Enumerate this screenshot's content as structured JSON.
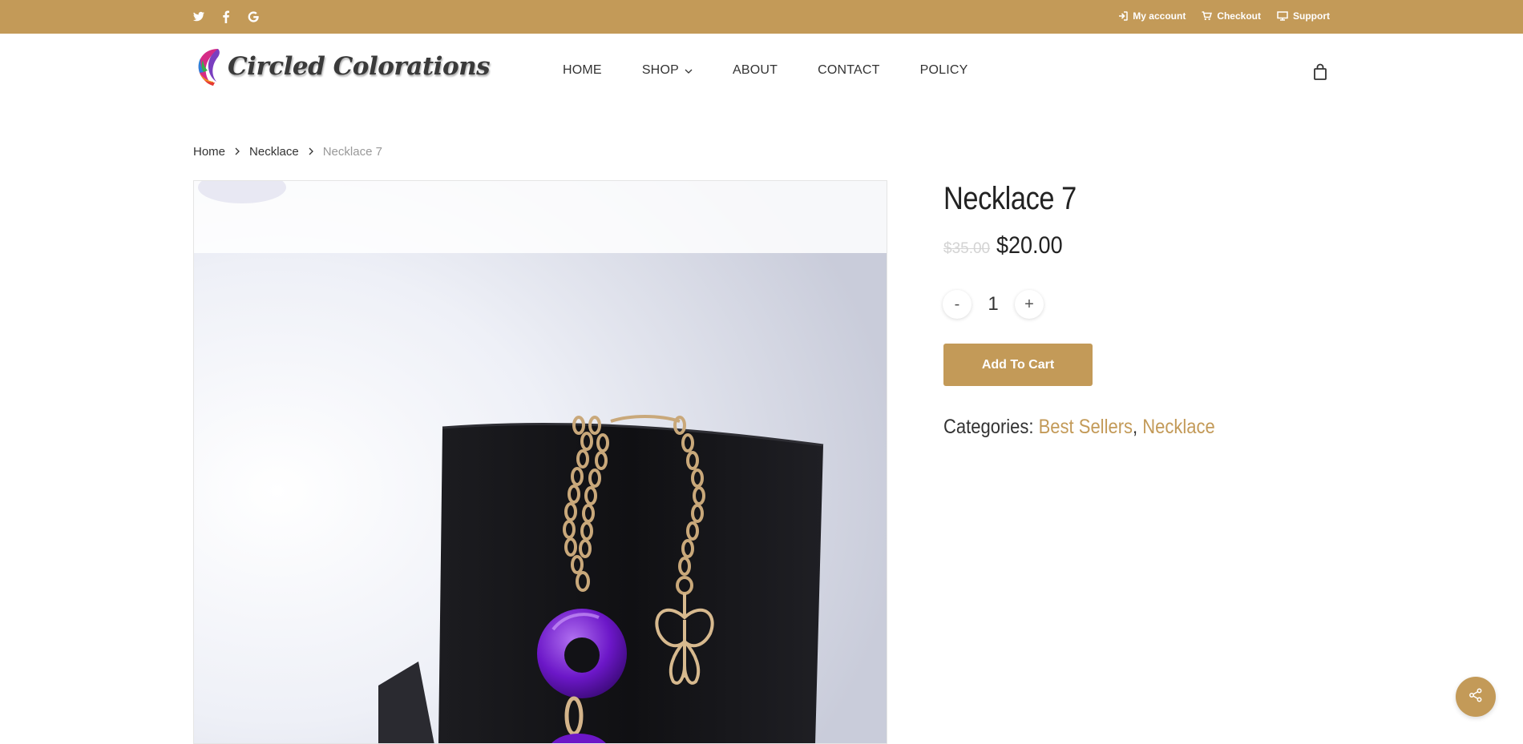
{
  "topbar": {
    "social": [
      "twitter-icon",
      "facebook-icon",
      "google-icon"
    ],
    "links": [
      {
        "label": "My account",
        "icon": "sign-in-icon"
      },
      {
        "label": "Checkout",
        "icon": "cart-icon"
      },
      {
        "label": "Support",
        "icon": "monitor-icon"
      }
    ]
  },
  "header": {
    "logo_text": "Circled Colorations",
    "nav": [
      "HOME",
      "SHOP",
      "ABOUT",
      "CONTACT",
      "POLICY"
    ]
  },
  "breadcrumb": {
    "items": [
      "Home",
      "Necklace"
    ],
    "current": "Necklace 7"
  },
  "product": {
    "title": "Necklace 7",
    "old_price": "$35.00",
    "price": "$20.00",
    "quantity": "1",
    "minus_label": "-",
    "plus_label": "+",
    "add_to_cart": "Add To Cart",
    "categories_label": "Categories:",
    "categories": [
      "Best Sellers",
      "Necklace"
    ],
    "category_separator": ","
  },
  "colors": {
    "accent": "#c39a58",
    "text": "#222222"
  }
}
